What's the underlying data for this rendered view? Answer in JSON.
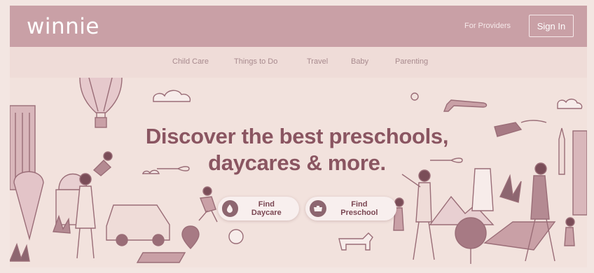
{
  "header": {
    "logo": "winnie",
    "for_providers": "For Providers",
    "sign_in": "Sign In"
  },
  "nav": {
    "items": [
      {
        "label": "Child Care"
      },
      {
        "label": "Things to Do"
      },
      {
        "label": "Travel"
      },
      {
        "label": "Baby"
      },
      {
        "label": "Parenting"
      }
    ]
  },
  "hero": {
    "headline_line1": "Discover the best preschools,",
    "headline_line2": "daycares & more."
  },
  "cta": {
    "daycare": {
      "label": "Find Daycare",
      "icon": "daycare-icon"
    },
    "preschool": {
      "label": "Find Preschool",
      "icon": "preschool-icon"
    }
  },
  "colors": {
    "header_bg": "#c9a0a6",
    "nav_bg": "#efdcd8",
    "page_bg": "#f2e2dd",
    "headline": "#8a5561",
    "illustration": "#9a6d77"
  }
}
